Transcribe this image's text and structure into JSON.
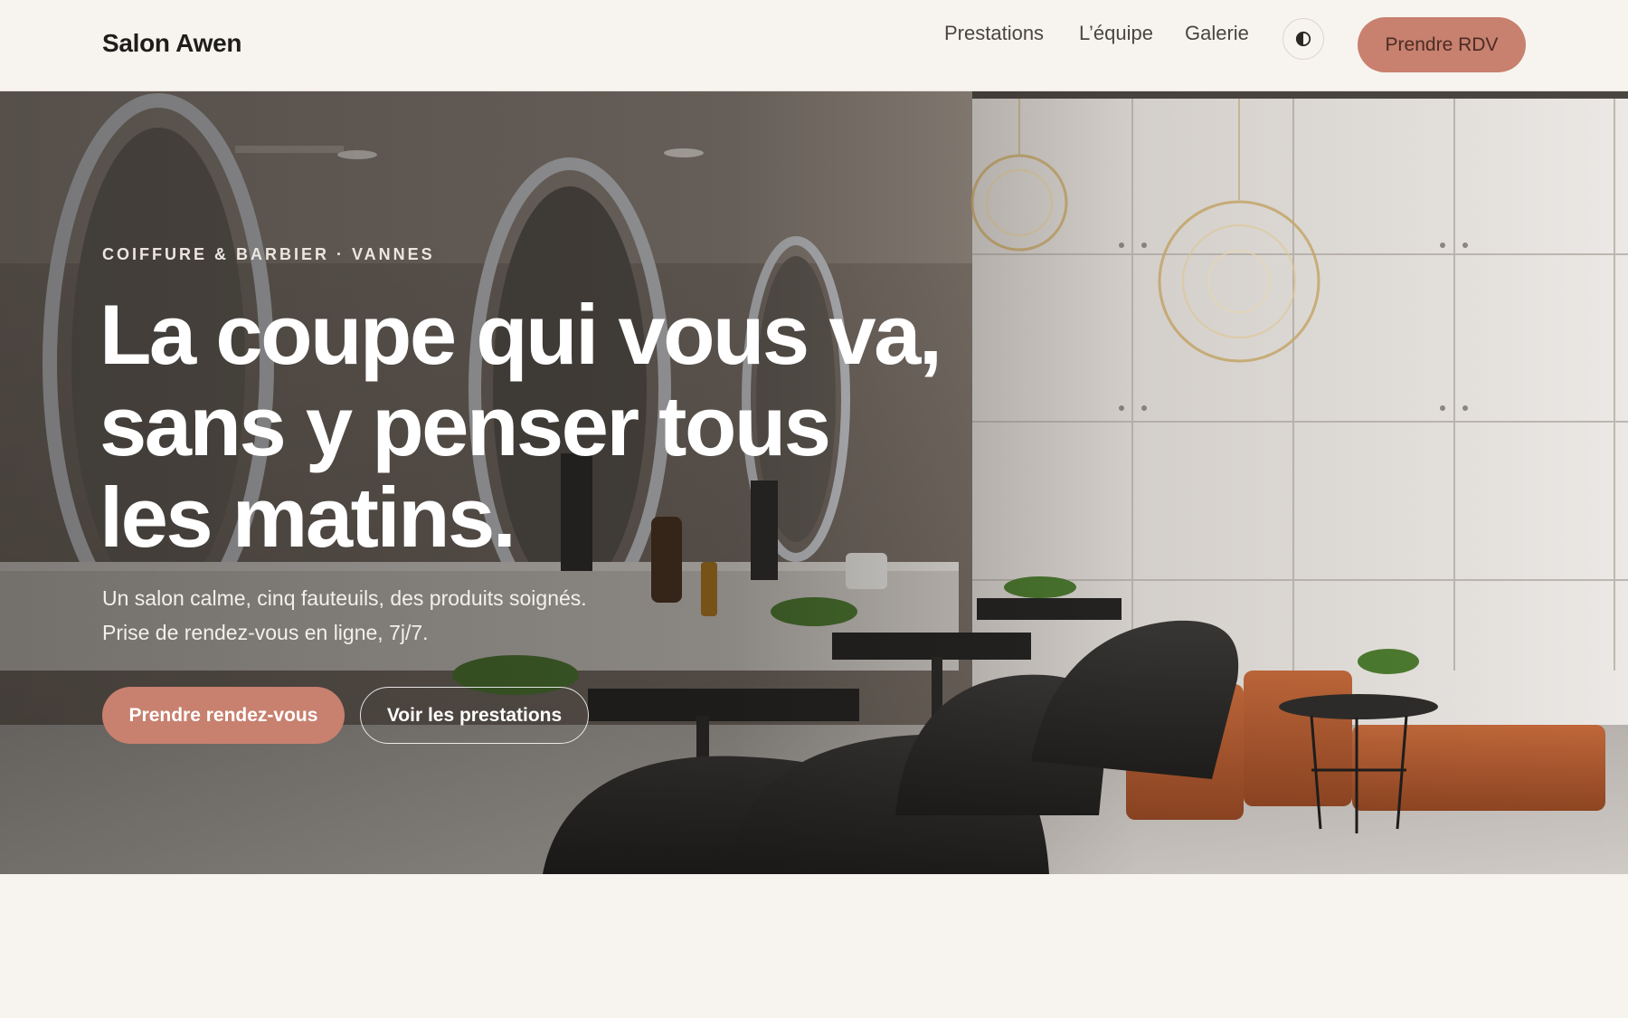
{
  "header": {
    "brand": "Salon Awen",
    "nav": [
      "Prestations",
      "L’équipe",
      "Galerie"
    ],
    "theme_toggle_icon": "contrast-icon",
    "cta_label": "Prendre RDV"
  },
  "hero": {
    "eyebrow": "COIFFURE & BARBIER · VANNES",
    "headline_lines": [
      "La coupe qui vous va,",
      "sans y penser tous",
      "les matins."
    ],
    "subtitle_lines": [
      "Un salon calme, cinq fauteuils, des produits soignés.",
      "Prise de rendez-vous en ligne, 7j/7."
    ],
    "primary_cta": "Prendre rendez-vous",
    "secondary_cta": "Voir les prestations"
  },
  "colors": {
    "accent": "#c8806f",
    "background": "#f7f4ef",
    "text_dark": "#1f1d1b"
  }
}
